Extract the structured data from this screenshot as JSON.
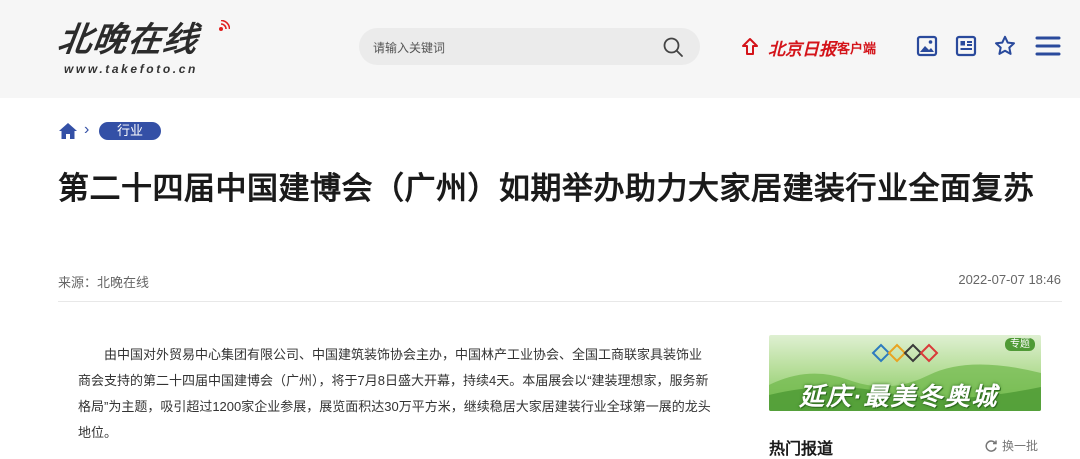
{
  "header": {
    "logo_text": "北晚在线",
    "logo_url": "www.takefoto.cn",
    "search_placeholder": "请输入关键词",
    "bjd_name": "北京日报",
    "bjd_suffix": "客户端",
    "icons": [
      "image-icon",
      "newspaper-icon",
      "star-icon",
      "menu-icon"
    ]
  },
  "breadcrumb": {
    "category": "行业"
  },
  "article": {
    "title": "第二十四届中国建博会（广州）如期举办助力大家居建装行业全面复苏",
    "source": "来源：北晚在线",
    "time": "2022-07-07 18:46",
    "paragraph": "由中国对外贸易中心集团有限公司、中国建筑装饰协会主办，中国林产工业协会、全国工商联家具装饰业商会支持的第二十四届中国建博会（广州），将于7月8日盛大开幕，持续4天。本届展会以“建装理想家，服务新格局”为主题，吸引超过1200家企业参展，展览面积达30万平方米，继续稳居大家居建装行业全球第一展的龙头地位。"
  },
  "sidebar": {
    "banner_tag": "专题",
    "banner_text": "延庆·最美冬奥城",
    "hot_title": "热门报道",
    "refresh_label": "换一批"
  },
  "colors": {
    "accent": "#3450a6",
    "brand_red": "#d4141a",
    "header_bg": "#f6f6f6"
  }
}
